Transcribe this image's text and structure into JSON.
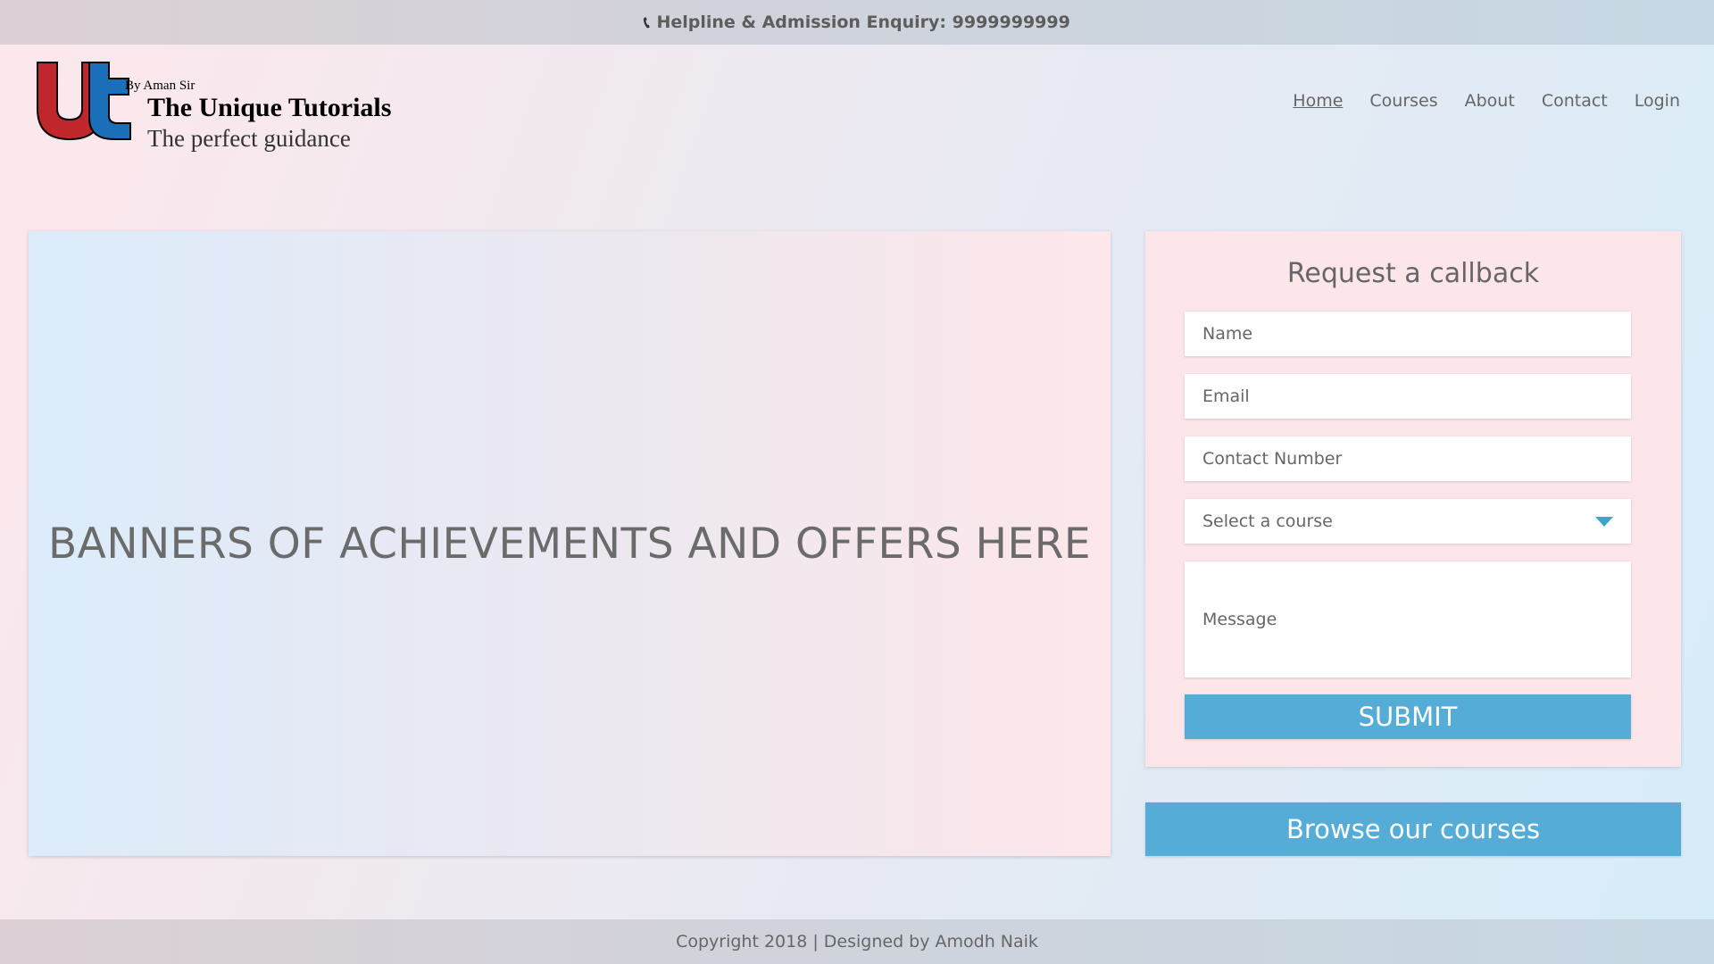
{
  "topbar": {
    "phone_icon": "phone-icon",
    "text": "Helpline & Admission Enquiry: 9999999999"
  },
  "logo": {
    "by": "By Aman Sir",
    "brand": "The Unique Tutorials",
    "tagline": "The perfect guidance",
    "colors": {
      "u": "#c0272d",
      "t": "#1a6fb8"
    }
  },
  "nav": {
    "items": [
      {
        "label": "Home",
        "active": true
      },
      {
        "label": "Courses"
      },
      {
        "label": "About"
      },
      {
        "label": "Contact"
      },
      {
        "label": "Login"
      }
    ]
  },
  "banner": {
    "text": "BANNERS OF ACHIEVEMENTS AND OFFERS HERE"
  },
  "callback": {
    "title": "Request a callback",
    "name_placeholder": "Name",
    "email_placeholder": "Email",
    "contact_placeholder": "Contact Number",
    "course_select": "Select a course",
    "message_placeholder": "Message",
    "submit_label": "SUBMIT"
  },
  "browse_label": "Browse our courses",
  "footer": {
    "text": "Copyright 2018 | Designed by Amodh Naik"
  },
  "colors": {
    "accent": "#55acd6",
    "caret": "#3ea3d1"
  }
}
